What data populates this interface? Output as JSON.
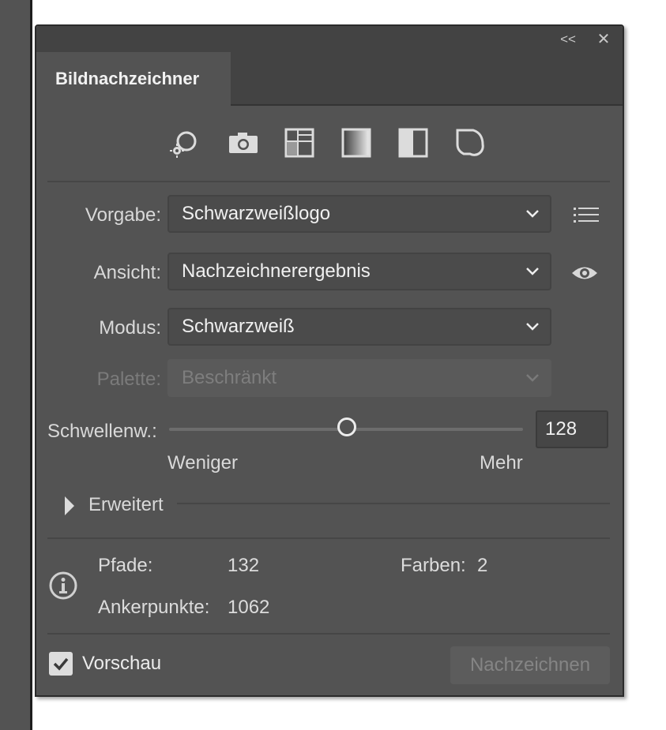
{
  "panel": {
    "title_tab": "Bildnachzeichner",
    "collapse_glyph": "<<",
    "close_glyph": "✕"
  },
  "presets": [
    {
      "icon": "auto-color-icon"
    },
    {
      "icon": "camera-icon"
    },
    {
      "icon": "low-color-icon"
    },
    {
      "icon": "grayscale-icon"
    },
    {
      "icon": "black-white-icon"
    },
    {
      "icon": "outline-icon"
    }
  ],
  "fields": {
    "vorgabe_label": "Vorgabe:",
    "vorgabe_value": "Schwarzweißlogo",
    "ansicht_label": "Ansicht:",
    "ansicht_value": "Nachzeichnerergebnis",
    "modus_label": "Modus:",
    "modus_value": "Schwarzweiß",
    "palette_label": "Palette:",
    "palette_value": "Beschränkt"
  },
  "threshold": {
    "label": "Schwellenw.:",
    "value": "128",
    "level_fraction": 0.502,
    "min_label": "Weniger",
    "max_label": "Mehr"
  },
  "advanced": {
    "label": "Erweitert"
  },
  "info": {
    "paths_label": "Pfade:",
    "paths_value": "132",
    "colors_label": "Farben:",
    "colors_value": "2",
    "anchors_label": "Ankerpunkte:",
    "anchors_value": "1062"
  },
  "footer": {
    "preview_label": "Vorschau",
    "preview_checked": true,
    "trace_button": "Nachzeichnen"
  },
  "colors": {
    "panel_bg": "#535353",
    "tabstrip_bg": "#434343"
  }
}
